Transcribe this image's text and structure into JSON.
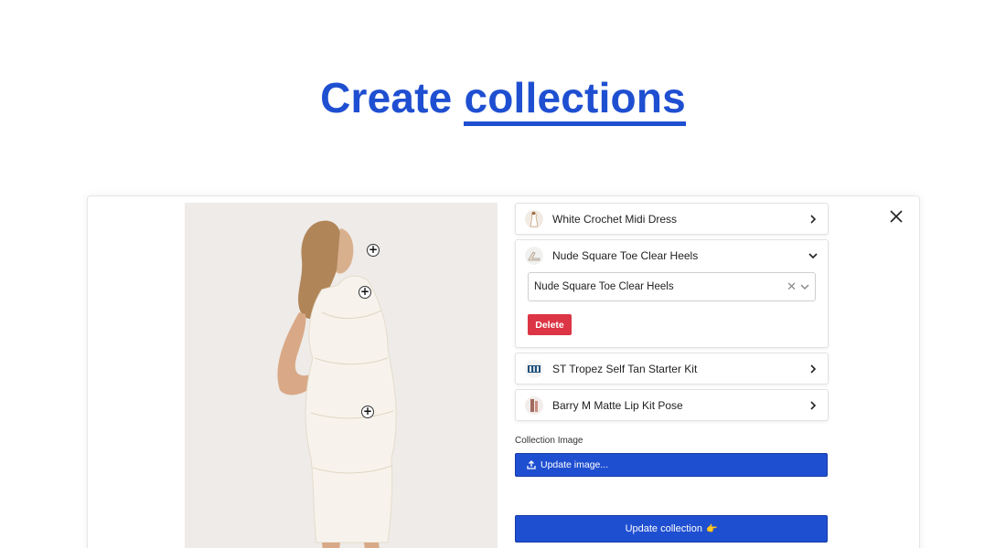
{
  "hero": {
    "title_prefix": "Create",
    "title_accent": "collections"
  },
  "items": [
    {
      "label": "White Crochet Midi Dress",
      "thumb": "dress-thumbnail",
      "expanded": false
    },
    {
      "label": "Nude Square Toe Clear Heels",
      "thumb": "heels-thumbnail",
      "expanded": true,
      "select_value": "Nude Square Toe Clear Heels",
      "delete_label": "Delete"
    },
    {
      "label": "ST Tropez Self Tan Starter Kit",
      "thumb": "tan-kit-thumbnail",
      "expanded": false
    },
    {
      "label": "Barry M Matte Lip Kit Pose",
      "thumb": "lip-kit-thumbnail",
      "expanded": false
    }
  ],
  "collection_image": {
    "label": "Collection Image",
    "button_label": "Update image..."
  },
  "update_collection": {
    "label": "Update collection",
    "emoji": "👉"
  },
  "hotspots": [
    {
      "symbol": "+"
    },
    {
      "symbol": "+"
    },
    {
      "symbol": "+"
    }
  ],
  "icons": {
    "close": "close-icon",
    "upload": "upload-icon",
    "chevron_right": "chevron-right-icon",
    "chevron_down": "chevron-down-icon"
  },
  "colors": {
    "accent": "#1f4fd1",
    "danger": "#dc3545"
  }
}
